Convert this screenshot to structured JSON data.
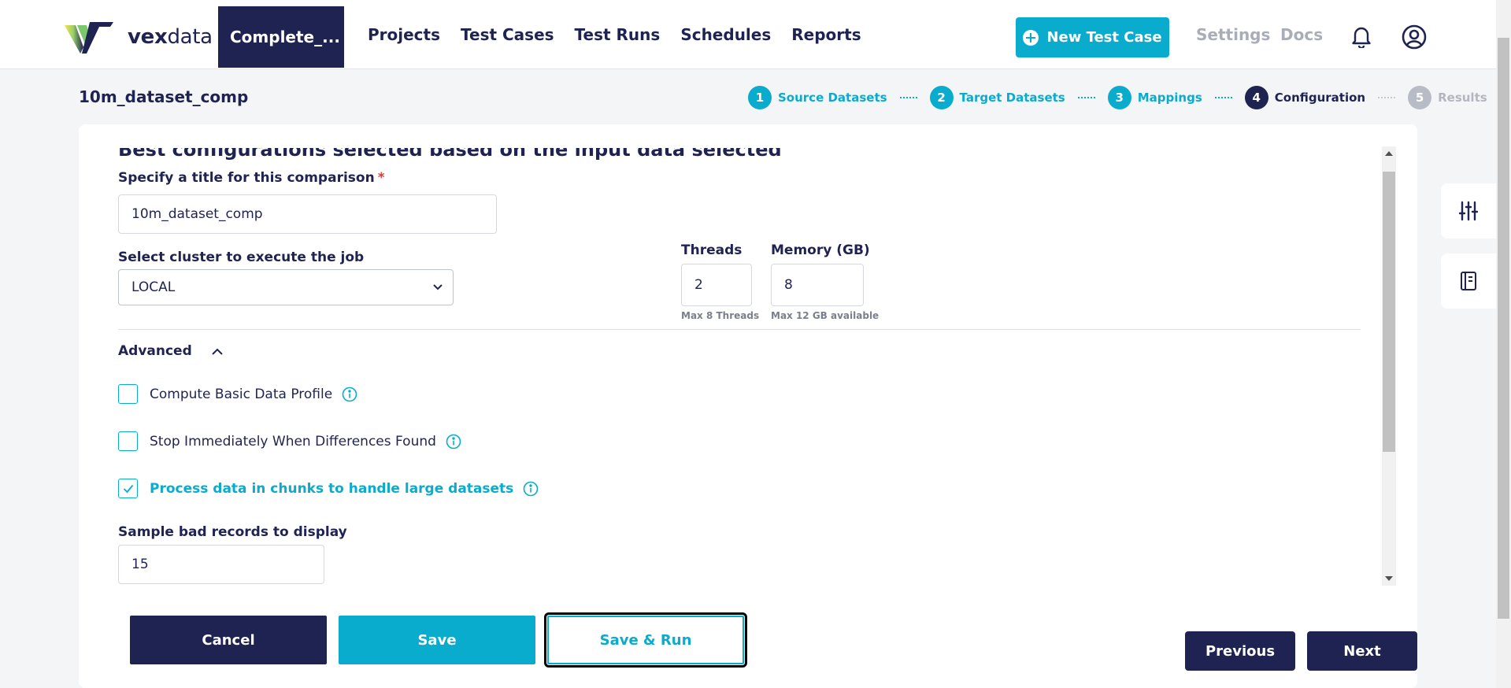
{
  "brand": {
    "prefix": "vex",
    "suffix": "data"
  },
  "header": {
    "active_tab": "Complete_...",
    "nav": [
      "Projects",
      "Test Cases",
      "Test Runs",
      "Schedules",
      "Reports"
    ],
    "new_button": "New Test Case",
    "settings": "Settings",
    "docs": "Docs",
    "icons": [
      "plus-circle-icon",
      "bell-icon",
      "user-circle-icon"
    ]
  },
  "page": {
    "title": "10m_dataset_comp"
  },
  "steps": [
    {
      "num": "1",
      "label": "Source Datasets",
      "state": "done"
    },
    {
      "num": "2",
      "label": "Target Datasets",
      "state": "done"
    },
    {
      "num": "3",
      "label": "Mappings",
      "state": "done"
    },
    {
      "num": "4",
      "label": "Configuration",
      "state": "current"
    },
    {
      "num": "5",
      "label": "Results",
      "state": "todo"
    }
  ],
  "config": {
    "section_title": "Best configurations selected based on the input data selected",
    "title_label": "Specify a title for this comparison",
    "required_mark": "*",
    "title_value": "10m_dataset_comp",
    "cluster_label": "Select cluster to execute the job",
    "cluster_value": "LOCAL",
    "threads_label": "Threads",
    "threads_value": "2",
    "threads_hint": "Max 8 Threads",
    "memory_label": "Memory (GB)",
    "memory_value": "8",
    "memory_hint": "Max 12 GB available",
    "advanced_label": "Advanced",
    "options": [
      {
        "label": "Compute Basic Data Profile",
        "checked": false
      },
      {
        "label": "Stop Immediately When Differences Found",
        "checked": false
      },
      {
        "label": "Process data in chunks to handle large datasets",
        "checked": true
      }
    ],
    "sample_label": "Sample bad records to display",
    "sample_value": "15"
  },
  "actions": {
    "cancel": "Cancel",
    "save": "Save",
    "save_run": "Save & Run",
    "previous": "Previous",
    "next": "Next"
  },
  "colors": {
    "primary": "#1f2352",
    "accent": "#0aaccd",
    "muted": "#a9adb8"
  }
}
